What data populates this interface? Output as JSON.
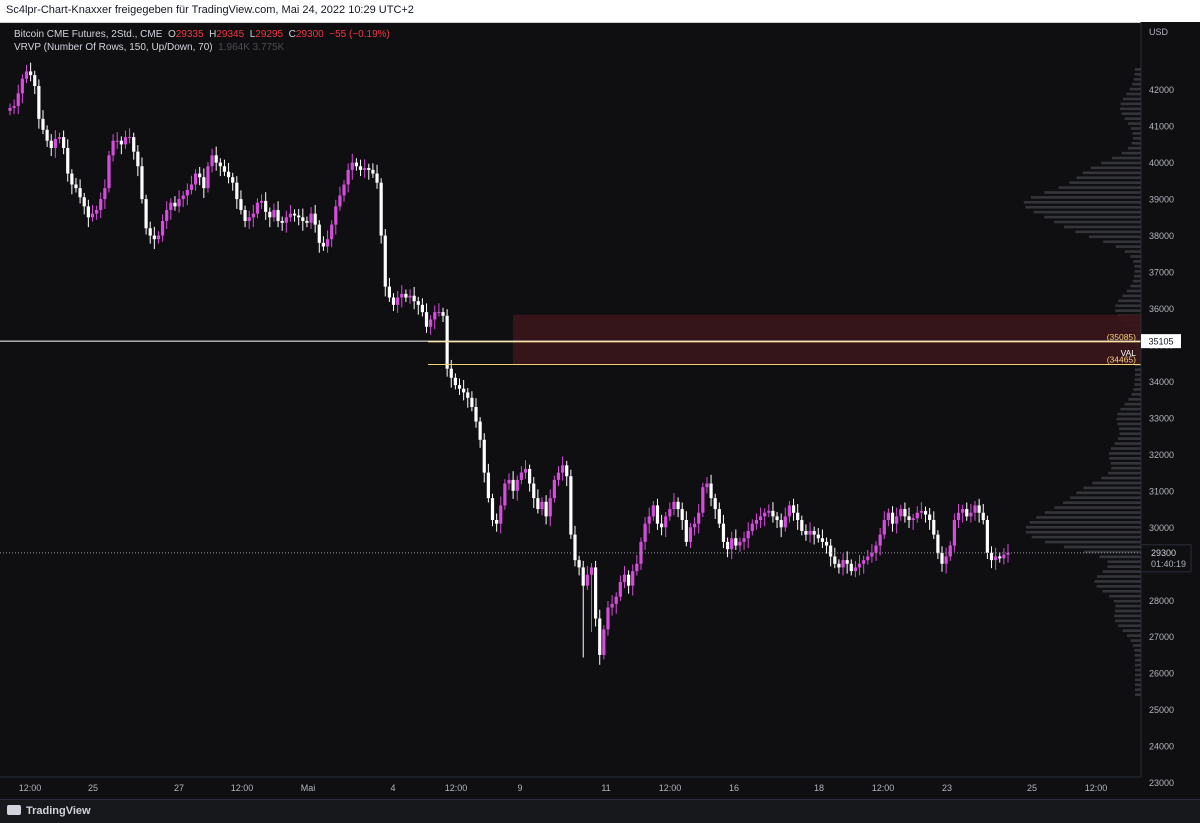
{
  "header": {
    "text": "Sc4lpr-Chart-Knaxxer freigegeben für TradingView.com, Mai 24, 2022 10:29 UTC+2"
  },
  "legend": {
    "symbol": "Bitcoin CME Futures, 2Std., CME",
    "open_label": "O",
    "open": "29335",
    "high_label": "H",
    "high": "29345",
    "low_label": "L",
    "low": "29295",
    "close_label": "C",
    "close": "29300",
    "change": "−55 (−0.19%)",
    "indicator": "VRVP (Number Of Rows, 150, Up/Down, 70)",
    "indicator_values": "1.964K  3.775K"
  },
  "footer": {
    "brand": "TradingView"
  },
  "colors": {
    "background": "#0f0f11",
    "up": "#d54ddc",
    "down": "#ffffff",
    "zone_fill": "#3a161b",
    "zone_line": "#f5d27a",
    "volume_profile": "#3b3c42"
  },
  "chart_data": {
    "type": "candlestick",
    "currency": "USD",
    "ylim": [
      23000,
      43000
    ],
    "yticks": [
      23000,
      24000,
      25000,
      26000,
      27000,
      28000,
      29000,
      30000,
      31000,
      32000,
      33000,
      34000,
      35000,
      36000,
      37000,
      38000,
      39000,
      40000,
      41000,
      42000
    ],
    "xticks": [
      "12:00",
      "25",
      "27",
      "12:00",
      "Mai",
      "4",
      "12:00",
      "9",
      "11",
      "12:00",
      "16",
      "18",
      "12:00",
      "23",
      "25",
      "12:00"
    ],
    "close_series": [
      41500,
      41550,
      41900,
      42300,
      42500,
      42400,
      42100,
      41200,
      40900,
      40600,
      40400,
      40650,
      40700,
      40400,
      39700,
      39400,
      39300,
      39050,
      38800,
      38500,
      38600,
      38700,
      39000,
      39300,
      40200,
      40600,
      40600,
      40500,
      40700,
      40700,
      40300,
      39900,
      39000,
      38200,
      38000,
      37900,
      38000,
      38400,
      38700,
      38900,
      38800,
      39000,
      39100,
      39250,
      39400,
      39700,
      39600,
      39300,
      39900,
      40200,
      40000,
      39900,
      39750,
      39600,
      39450,
      39000,
      38700,
      38400,
      38500,
      38600,
      38900,
      38950,
      38650,
      38500,
      38700,
      38400,
      38350,
      38500,
      38600,
      38550,
      38500,
      38400,
      38350,
      38600,
      38300,
      37800,
      37700,
      37900,
      38300,
      38800,
      39100,
      39400,
      39800,
      40000,
      39900,
      39800,
      39850,
      39800,
      39700,
      39450,
      38000,
      36600,
      36300,
      36100,
      36300,
      36400,
      36300,
      36350,
      36200,
      36100,
      35900,
      35500,
      35700,
      35900,
      35900,
      35800,
      34350,
      34100,
      33900,
      33800,
      33700,
      33550,
      33300,
      32900,
      32400,
      31500,
      30800,
      30200,
      30100,
      30600,
      31200,
      31300,
      31000,
      31300,
      31500,
      31600,
      31200,
      30800,
      30500,
      30700,
      30300,
      30800,
      31300,
      31500,
      31700,
      31400,
      29800,
      29100,
      28900,
      28400,
      28700,
      28900,
      27500,
      26500,
      27200,
      27800,
      27900,
      28100,
      28500,
      28700,
      28400,
      28800,
      29000,
      29600,
      30100,
      30300,
      30600,
      30100,
      30000,
      30300,
      30500,
      30700,
      30500,
      30200,
      29600,
      30000,
      30100,
      30400,
      31100,
      31200,
      30800,
      30500,
      30100,
      29600,
      29400,
      29700,
      29500,
      29600,
      29700,
      29900,
      30100,
      30200,
      30300,
      30400,
      30450,
      30300,
      30200,
      30000,
      30300,
      30600,
      30400,
      30200,
      29900,
      29800,
      29900,
      29800,
      29700,
      29600,
      29500,
      29200,
      29000,
      28900,
      29100,
      29000,
      28800,
      28900,
      29000,
      29100,
      29200,
      29300,
      29500,
      29800,
      30200,
      30400,
      30100,
      30300,
      30500,
      30300,
      30200,
      30250,
      30400,
      30450,
      30350,
      30200,
      29800,
      29300,
      29000,
      29200,
      29500,
      30200,
      30400,
      30500,
      30300,
      30400,
      30600,
      30400,
      30200,
      29300,
      29100,
      29200,
      29150,
      29250,
      29300
    ],
    "levels": [
      {
        "label": "35105",
        "value": 35105
      },
      {
        "label": "(35085)",
        "value": 35085
      },
      {
        "label": "VAL",
        "value": 34775
      },
      {
        "label": "(34465)",
        "value": 34465
      }
    ],
    "zone": {
      "top": 35830,
      "bottom": 34465
    },
    "last_price": {
      "label": "29300",
      "countdown": "01:40:19",
      "value": 29300
    }
  }
}
